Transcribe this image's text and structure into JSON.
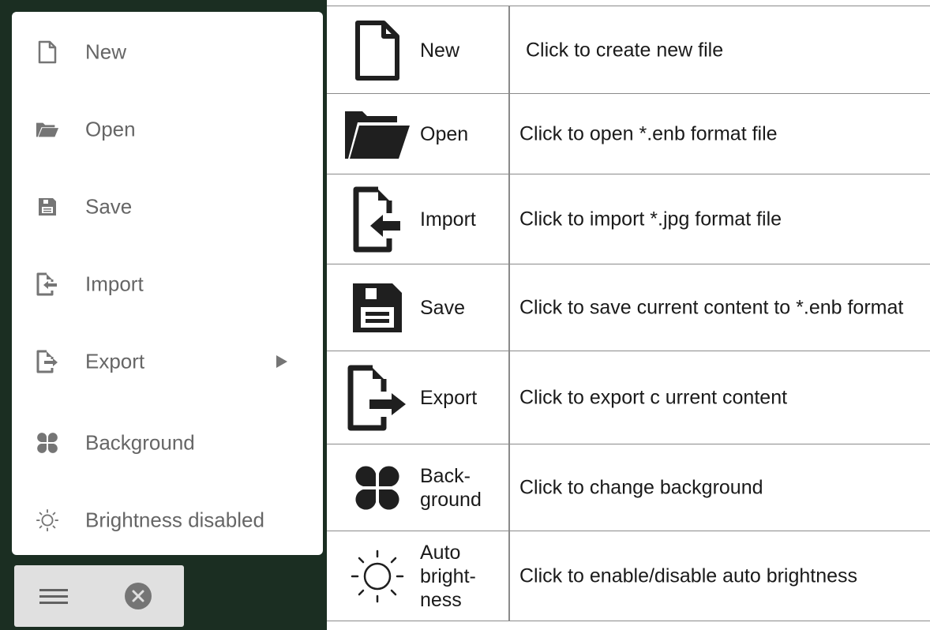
{
  "menu": {
    "items": [
      {
        "label": "New",
        "icon": "file-icon"
      },
      {
        "label": "Open",
        "icon": "folder-open-icon"
      },
      {
        "label": "Save",
        "icon": "save-icon"
      },
      {
        "label": "Import",
        "icon": "import-icon"
      },
      {
        "label": "Export",
        "icon": "export-icon",
        "submenu_arrow": "play-arrow-icon"
      },
      {
        "label": "Background",
        "icon": "clover-icon"
      },
      {
        "label": "Brightness disabled",
        "icon": "sun-icon"
      }
    ],
    "bottom_bar": {
      "menu_icon": "hamburger-menu-icon",
      "close_icon": "close-circle-icon"
    }
  },
  "reference": {
    "rows": [
      {
        "name": "New",
        "desc": "Click to create new file",
        "icon": "file-icon"
      },
      {
        "name": "Open",
        "desc": "Click to open *.enb format file",
        "icon": "folder-open-icon"
      },
      {
        "name": "Import",
        "desc": "Click to import *.jpg format file",
        "icon": "import-icon"
      },
      {
        "name": "Save",
        "desc": "Click to save current content to *.enb format",
        "icon": "save-icon"
      },
      {
        "name": "Export",
        "desc": "Click to export c urrent content",
        "icon": "export-icon"
      },
      {
        "name": "Back-\nground",
        "desc": "Click to change background",
        "icon": "clover-icon"
      },
      {
        "name": "Auto\nbright-\nness",
        "desc": "Click to enable/disable auto brightness",
        "icon": "sun-icon"
      }
    ]
  },
  "colors": {
    "panel_bg": "#1b2e22",
    "menu_icon": "#757575",
    "menu_text": "#666666",
    "table_icon": "#1f1f1f",
    "table_rule": "#8a8a8a"
  }
}
